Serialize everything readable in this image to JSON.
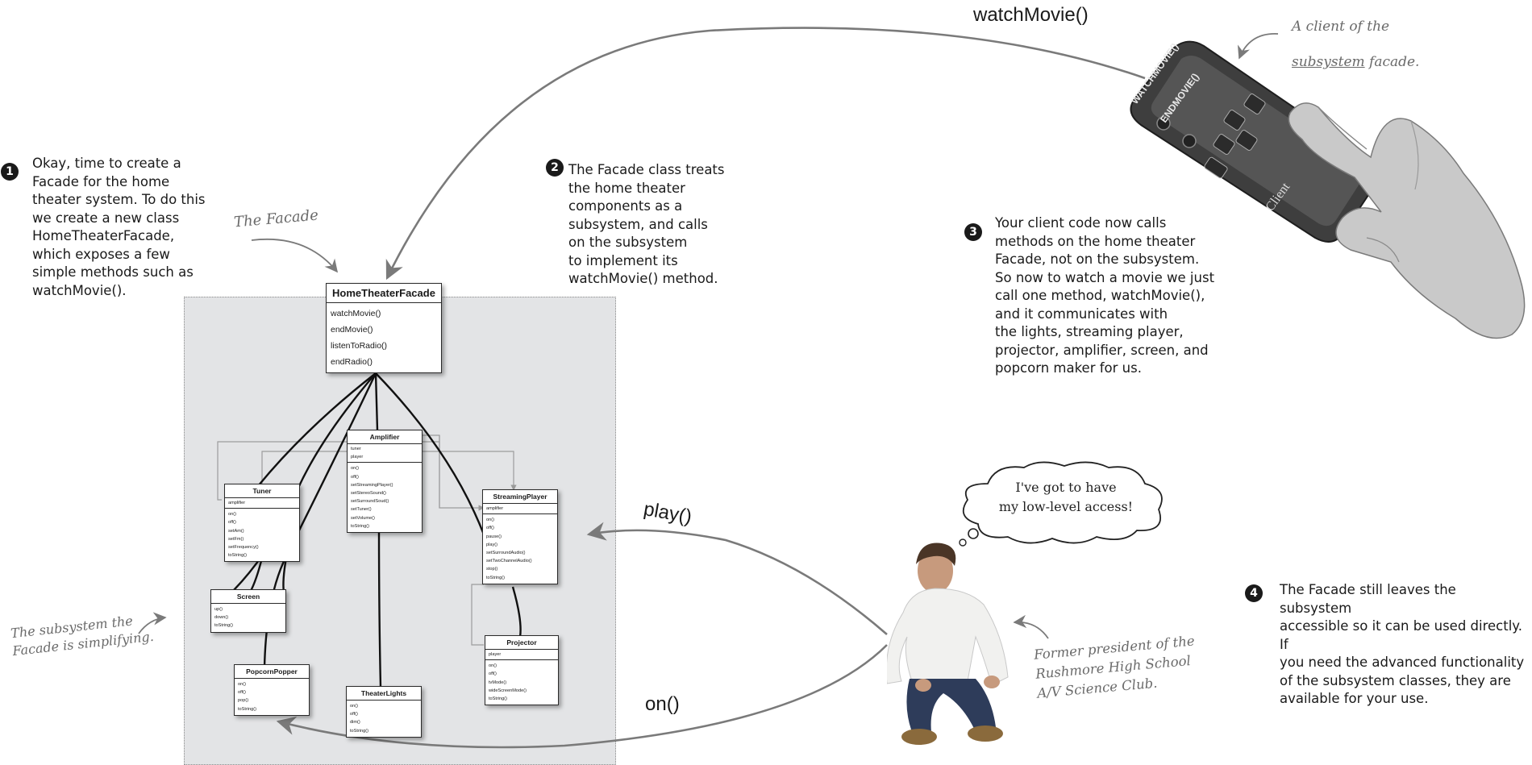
{
  "steps": [
    {
      "num": "1",
      "text": "Okay, time to create a\nFacade for the home\ntheater system. To do this\nwe create a new class\nHomeTheaterFacade,\nwhich exposes a few\nsimple methods such as\nwatchMovie()."
    },
    {
      "num": "2",
      "text": "The Facade class treats\nthe home theater\ncomponents as a\nsubsystem, and calls\non the subsystem\nto implement its\nwatchMovie() method."
    },
    {
      "num": "3",
      "text": "Your client code now calls\nmethods on the home theater\nFacade, not on the subsystem.\nSo now to watch a movie we just\ncall one method, watchMovie(),\nand it communicates with\nthe lights, streaming player,\nprojector, amplifier, screen, and\npopcorn maker for us."
    },
    {
      "num": "4",
      "text": "The Facade still leaves the subsystem\naccessible so it can be used directly. If\nyou need the advanced functionality\nof the subsystem classes, they are\navailable for your use."
    }
  ],
  "annotations": {
    "facade": "The Facade",
    "client_line1": "A client of the",
    "client_line2_a": "subsystem",
    "client_line2_b": " facade.",
    "subsystem": "The subsystem the\nFacade is simplifying.",
    "president": "Former president of the\nRushmore High School\nA/V Science Club."
  },
  "calls": {
    "watch": "watchMovie()",
    "play": "play()",
    "on": "on()"
  },
  "thought": "I've got to have\nmy low-level access!",
  "remote": {
    "btn1": "WATCHMOVIE()",
    "btn2": "ENDMOVIE()",
    "brand": "Client"
  },
  "facade_class": {
    "name": "HomeTheaterFacade",
    "methods": [
      "watchMovie()",
      "endMovie()",
      "listenToRadio()",
      "endRadio()"
    ]
  },
  "classes": {
    "amplifier": {
      "name": "Amplifier",
      "attrs": [
        "tuner",
        "player"
      ],
      "methods": [
        "on()",
        "off()",
        "setStreamingPlayer()",
        "setStereoSound()",
        "setSurroundSoud()",
        "setTuner()",
        "setVolume()",
        "toString()"
      ]
    },
    "tuner": {
      "name": "Tuner",
      "attrs": [
        "amplifier"
      ],
      "methods": [
        "on()",
        "off()",
        "setAm()",
        "setFm()",
        "setFrequency()",
        "toString()"
      ]
    },
    "streaming": {
      "name": "StreamingPlayer",
      "attrs": [
        "amplifier"
      ],
      "methods": [
        "on()",
        "off()",
        "pause()",
        "play()",
        "setSurroundAudio()",
        "setTwoChannelAudio()",
        "stop()",
        "toString()"
      ]
    },
    "screen": {
      "name": "Screen",
      "attrs": [],
      "methods": [
        "up()",
        "down()",
        "toString()"
      ]
    },
    "projector": {
      "name": "Projector",
      "attrs": [
        "player"
      ],
      "methods": [
        "on()",
        "off()",
        "tvMode()",
        "wideScreenMode()",
        "toString()"
      ]
    },
    "popcorn": {
      "name": "PopcornPopper",
      "attrs": [],
      "methods": [
        "on()",
        "off()",
        "pop()",
        "toString()"
      ]
    },
    "lights": {
      "name": "TheaterLights",
      "attrs": [],
      "methods": [
        "on()",
        "off()",
        "dim()",
        "toString()"
      ]
    }
  },
  "colors": {
    "subsystem_bg": "#e3e4e6",
    "ink": "#1a1a1a",
    "handwriting": "#6a6a6a"
  }
}
